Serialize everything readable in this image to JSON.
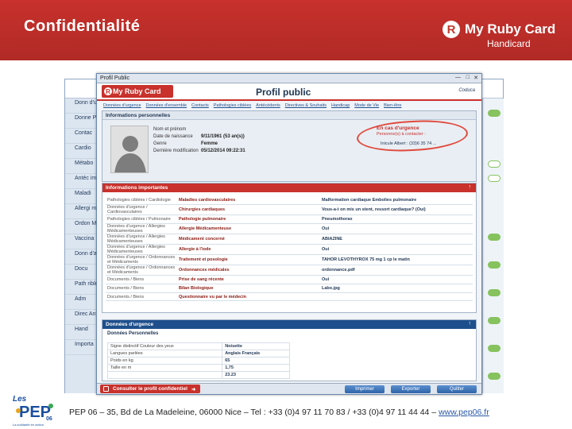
{
  "slide": {
    "title": "Confidentialité",
    "brand_name": "My Ruby Card",
    "brand_sub": "Handicard",
    "brand_mark": "R"
  },
  "background_app": {
    "side_items": [
      "Donn d'urg",
      "Donne Person",
      "Contac",
      "Cardio",
      "Métabo",
      "Antéc import",
      "Maladi",
      "Allergi médica",
      "Ordon Médica",
      "Vaccina",
      "Donn d'ano",
      "Docu",
      "Path rible",
      "Adm",
      "Direc Antic",
      "Hand",
      "Importa"
    ]
  },
  "window": {
    "titlebar": "Profil Public",
    "logo": "My Ruby Card",
    "heading": "Profil public",
    "org": "Coduca",
    "nav": [
      "Données d'urgence",
      "Données d'ensemble",
      "Contacts",
      "Pathologies ciblées",
      "Antécédents",
      "Directives & Souhaits",
      "Handicap",
      "Mode de Vie",
      "Bien-être"
    ],
    "personal": {
      "section_title": "Informations personnelles",
      "rows": [
        {
          "label": "Nom et prénom",
          "value": ""
        },
        {
          "label": "Date de naissance",
          "value": "9/11/1961 (53 an(s))"
        },
        {
          "label": "Genre",
          "value": "Femme"
        },
        {
          "label": "Dernière modification",
          "value": "05/12/2014 09:22:31"
        }
      ],
      "callout_title": "En cas d'urgence",
      "callout_sub": "Personne(s) à contacter :",
      "callout_contact": "Inicule Albert : (33)6 35 74 ..."
    },
    "important": {
      "section_title": "Informations importantes",
      "rows": [
        [
          "Pathologies ciblées / Cardiologie",
          "Maladies cardiovasculaires",
          "Malformation cardiaque Embolies pulmonaire"
        ],
        [
          "Données d'urgence / Cardiovasculaires",
          "Chirurgies cardiaques",
          "Vous-a-t on mis un stent, ressort cardiaque? (Oui)"
        ],
        [
          "Pathologies ciblées / Pulmonaire",
          "Pathologie pulmonaire",
          "Pneumothorax"
        ],
        [
          "Données d'urgence / Allergies Médicamenteuses",
          "Allergie Médicamenteuse",
          "Oui"
        ],
        [
          "Données d'urgence / Allergies Médicamenteuses",
          "Médicament concerné",
          "ABIAZINE"
        ],
        [
          "Données d'urgence / Allergies Médicamenteuses",
          "Allergie à l'iode",
          "Oui"
        ],
        [
          "Données d'urgence / Ordonnances et Médicaments",
          "Traitement et posologie",
          "TAHOR LEVOTHYROX 75 mg 1 cp le matin"
        ],
        [
          "Données d'urgence / Ordonnances et Médicaments",
          "Ordonnances médicales",
          "ordonnance.pdf"
        ],
        [
          "Documents / Biens",
          "Prise de sang récente",
          "Oui"
        ],
        [
          "Documents / Biens",
          "Bilan Biologique",
          "Labo.jpg"
        ],
        [
          "Documents / Biens",
          "Questionnaire vu par le médecin",
          ""
        ]
      ]
    },
    "emergency": {
      "section_title": "Données d'urgence",
      "subtitle": "Données Personnelles",
      "rows": [
        [
          "Signe distinctif Couleur des yeux",
          "Noisette"
        ],
        [
          "Langues parlées",
          "Anglais Français"
        ],
        [
          "Poids en kg",
          "65"
        ],
        [
          "Taille en m",
          "1,75"
        ],
        [
          "",
          "23.23"
        ]
      ]
    },
    "footer": {
      "confidential_button": "Consulter le profil confidentiel",
      "print": "Imprimer",
      "export": "Exporter",
      "quit": "Quitter"
    }
  },
  "bottom": {
    "pep_logo_text": "Les PEP 06",
    "pep_tagline": "La solidarité en action",
    "footer_text": "PEP 06 – 35, Bd de La Madeleine, 06000 Nice – Tel : +33 (0)4 97 11 70 83 / +33 (0)4 97 11 44 44 –",
    "footer_link": "www.pep06.fr"
  },
  "colors": {
    "accent": "#c8312c",
    "navy": "#1e4f8c",
    "link": "#2a58a8"
  }
}
